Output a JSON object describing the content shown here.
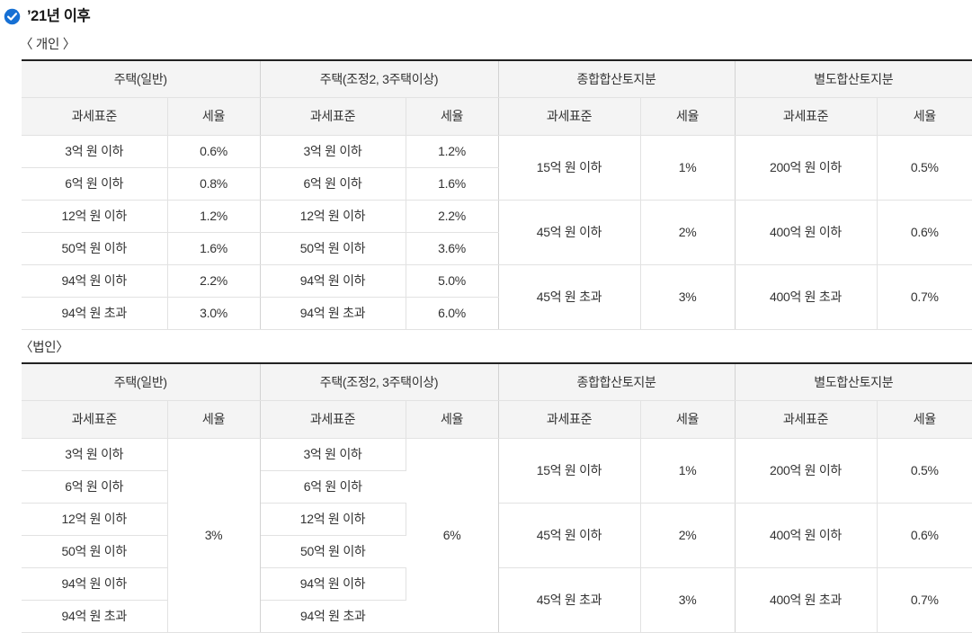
{
  "header": {
    "icon": "check-circle-icon",
    "title": "’21년 이후",
    "accent_color": "#1670d4"
  },
  "tables": [
    {
      "caption": "〈 개인 〉",
      "id": "individual",
      "group_headers": [
        "주택(일반)",
        "주택(조정2, 3주택이상)",
        "종합합산토지분",
        "별도합산토지분"
      ],
      "sub_headers": {
        "base": "과세표준",
        "rate": "세율"
      },
      "housing_general": {
        "bases": [
          "3억 원 이하",
          "6억 원 이하",
          "12억 원 이하",
          "50억 원 이하",
          "94억 원 이하",
          "94억 원 초과"
        ],
        "rates": [
          "0.6%",
          "0.8%",
          "1.2%",
          "1.6%",
          "2.2%",
          "3.0%"
        ],
        "merged_rate": null
      },
      "housing_adjusted": {
        "bases": [
          "3억 원 이하",
          "6억 원 이하",
          "12억 원 이하",
          "50억 원 이하",
          "94억 원 이하",
          "94억 원 초과"
        ],
        "rates": [
          "1.2%",
          "1.6%",
          "2.2%",
          "3.6%",
          "5.0%",
          "6.0%"
        ],
        "merged_rate": null
      },
      "land_aggregate": {
        "bases": [
          "15억 원 이하",
          "45억 원 이하",
          "45억 원 초과"
        ],
        "rates": [
          "1%",
          "2%",
          "3%"
        ]
      },
      "land_separate": {
        "bases": [
          "200억 원 이하",
          "400억 원 이하",
          "400억 원 초과"
        ],
        "rates": [
          "0.5%",
          "0.6%",
          "0.7%"
        ]
      }
    },
    {
      "caption": "〈법인〉",
      "id": "corporate",
      "group_headers": [
        "주택(일반)",
        "주택(조정2, 3주택이상)",
        "종합합산토지분",
        "별도합산토지분"
      ],
      "sub_headers": {
        "base": "과세표준",
        "rate": "세율"
      },
      "housing_general": {
        "bases": [
          "3억 원 이하",
          "6억 원 이하",
          "12억 원 이하",
          "50억 원 이하",
          "94억 원 이하",
          "94억 원 초과"
        ],
        "rates": [],
        "merged_rate": "3%"
      },
      "housing_adjusted": {
        "bases": [
          "3억 원 이하",
          "6억 원 이하",
          "12억 원 이하",
          "50억 원 이하",
          "94억 원 이하",
          "94억 원 초과"
        ],
        "rates": [],
        "merged_rate": "6%"
      },
      "land_aggregate": {
        "bases": [
          "15억 원 이하",
          "45억 원 이하",
          "45억 원 초과"
        ],
        "rates": [
          "1%",
          "2%",
          "3%"
        ]
      },
      "land_separate": {
        "bases": [
          "200억 원 이하",
          "400억 원 이하",
          "400억 원 초과"
        ],
        "rates": [
          "0.5%",
          "0.6%",
          "0.7%"
        ]
      }
    }
  ]
}
